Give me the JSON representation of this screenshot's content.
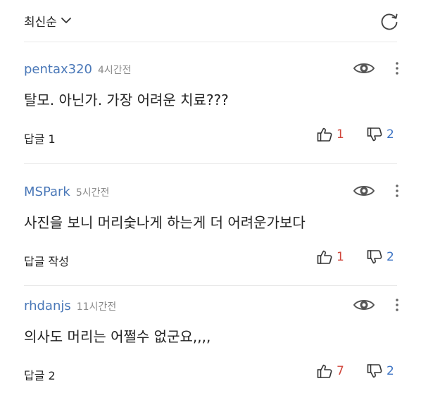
{
  "header": {
    "sort_label": "최신순"
  },
  "comments": [
    {
      "author": "pentax320",
      "time": "4시간전",
      "text": "탈모. 아닌가. 가장 어려운 치료???",
      "reply": "답글 1",
      "likes": "1",
      "dislikes": "2"
    },
    {
      "author": "MSPark",
      "time": "5시간전",
      "text": "사진을 보니 머리숯나게 하는게 더 어려운가보다",
      "reply": "답글 작성",
      "likes": "1",
      "dislikes": "2"
    },
    {
      "author": "rhdanjs",
      "time": "11시간전",
      "text": "의사도 머리는 어쩔수 없군요,,,,",
      "reply": "답글 2",
      "likes": "7",
      "dislikes": "2"
    }
  ],
  "colors": {
    "author": "#4a78b8",
    "like": "#d0463b",
    "dislike": "#3c73c4",
    "icon": "#444444"
  },
  "icons": [
    "chevron-down-icon",
    "refresh-icon",
    "eye-icon",
    "more-vertical-icon",
    "thumbs-up-icon",
    "thumbs-down-icon"
  ]
}
